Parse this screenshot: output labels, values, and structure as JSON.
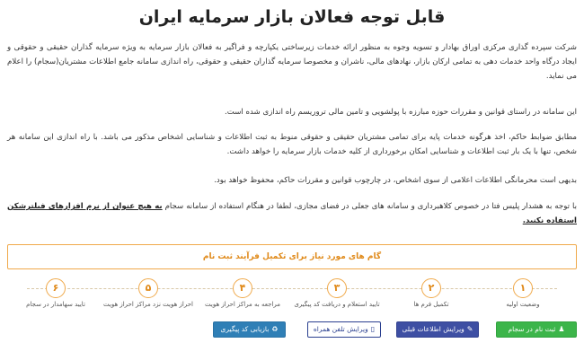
{
  "page": {
    "title": "قابل توجه فعالان بازار سرمایه ایران"
  },
  "paragraphs": {
    "p1": "شرکت سپرده گذاری مرکزی اوراق بهادار و تسویه وجوه به منظور ارائه خدمات زیرساختی یکپارچه و فراگیر به فعالان بازار سرمایه به ویژه سرمایه گذاران حقیقی و حقوقی و ایجاد درگاه واحد خدمات دهی به تمامی ارکان بازار، نهادهای مالی، ناشران و مخصوصا سرمایه گذاران حقیقی و حقوقی، راه اندازی سامانه جامع اطلاعات مشتریان(سجام) را اعلام می نماید.",
    "p2": "این سامانه در راستای قوانین و مقررات حوزه مبارزه با پولشویی و تامین مالی تروریسم راه اندازی شده است.",
    "p3": "مطابق ضوابط حاکم، اخذ هرگونه خدمات پایه برای تمامی مشتریان حقیقی و حقوقی منوط به ثبت اطلاعات و شناسایی اشخاص مذکور می باشد. با راه اندازی این سامانه هر شخص، تنها با یک بار ثبت اطلاعات و شناسایی امکان برخورداری از کلیه خدمات بازار سرمایه را خواهد داشت.",
    "p4": "بدیهی است محرمانگی اطلاعات اعلامی از سوی اشخاص، در چارچوب قوانین و مقررات حاکم، محفوظ خواهد بود.",
    "p5_normal": "با توجه به هشدار پلیس فتا در خصوص کلاهبرداری و سامانه های جعلی در فضای مجازی، لطفا در هنگام استفاده از سامانه سجام ",
    "p5_strong": "به هیچ عنوان از نرم افزارهای فیلترشکن استفاده نکنید."
  },
  "steps": {
    "title": "گام های مورد نیاز برای تکمیل فرآیند ثبت نام",
    "items": [
      {
        "num": "۱",
        "label": "وضعیت اولیه"
      },
      {
        "num": "۲",
        "label": "تکمیل فرم ها"
      },
      {
        "num": "۳",
        "label": "تایید استعلام و دریافت کد پیگیری"
      },
      {
        "num": "۴",
        "label": "مراجعه به مراکز احراز هویت"
      },
      {
        "num": "۵",
        "label": "احراز هویت نزد مراکز احراز هویت"
      },
      {
        "num": "۶",
        "label": "تایید سهامدار در سجام"
      }
    ]
  },
  "buttons": {
    "register": "ثبت نام در سجام",
    "edit_info": "ویرایش اطلاعات قبلی",
    "edit_phone": "ویرایش تلفن همراه",
    "recover_code": "بازیابی کد پیگیری"
  },
  "colors": {
    "accent_orange": "#f0a94a",
    "green": "#3cb54a",
    "indigo": "#3e4fa3",
    "blue": "#2f7fb6"
  }
}
